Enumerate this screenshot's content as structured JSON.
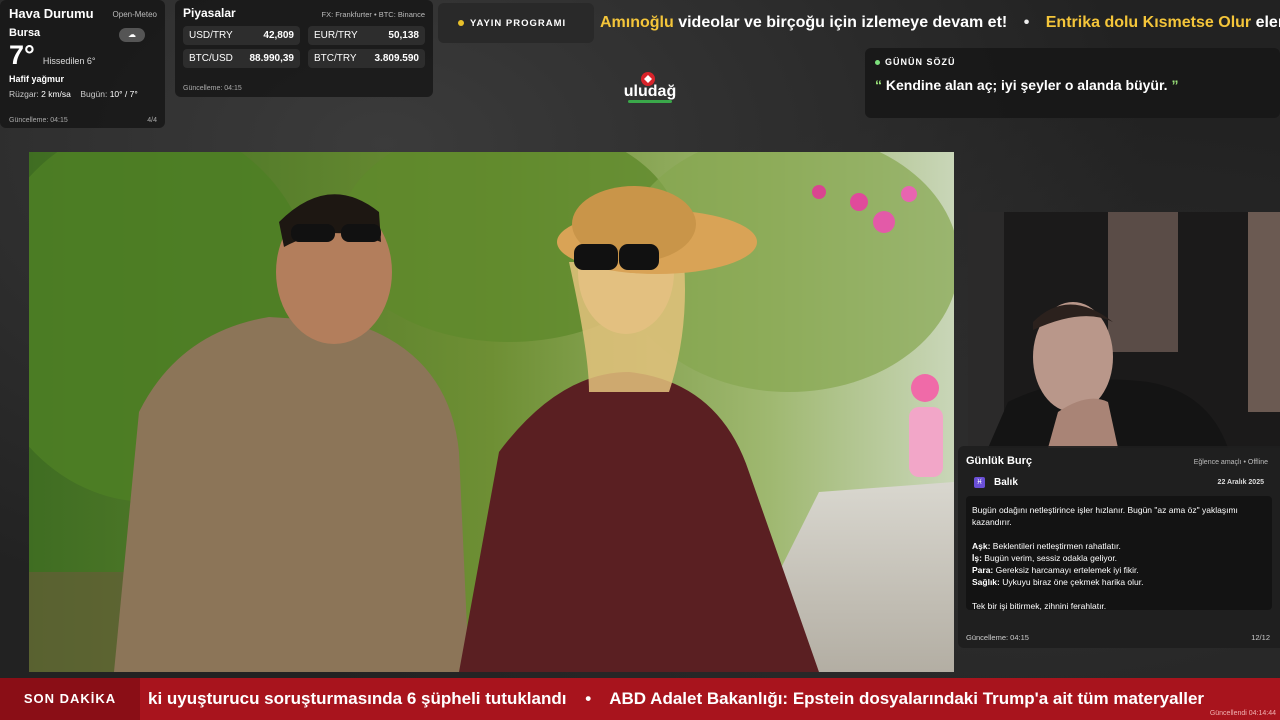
{
  "weather": {
    "title": "Hava Durumu",
    "source": "Open-Meteo",
    "city": "Bursa",
    "temp": "7°",
    "feels_like": "Hissedilen 6°",
    "condition": "Hafif yağmur",
    "wind_label": "Rüzgar:",
    "wind_value": "2 km/sa",
    "today_label": "Bugün:",
    "today_value": "10° / 7°",
    "updated": "Güncelleme: 04:15",
    "page": "4/4"
  },
  "markets": {
    "title": "Piyasalar",
    "source": "FX: Frankfurter • BTC: Binance",
    "items": [
      {
        "pair": "USD/TRY",
        "value": "42,809"
      },
      {
        "pair": "EUR/TRY",
        "value": "50,138"
      },
      {
        "pair": "BTC/USD",
        "value": "88.990,39"
      },
      {
        "pair": "BTC/TRY",
        "value": "3.809.590"
      }
    ],
    "updated": "Güncelleme: 04:15"
  },
  "schedule": {
    "label": "YAYIN PROGRAMI"
  },
  "top_marquee": {
    "items": [
      {
        "highlight": "Amınoğlu",
        "text": " videolar ve birçoğu için izlemeye devam et!"
      },
      {
        "highlight": "Entrika dolu Kısmetse Olur",
        "text": " eleme"
      }
    ],
    "separator": "•"
  },
  "logo": {
    "text": "uludağ"
  },
  "quote": {
    "title": "GÜNÜN SÖZÜ",
    "open_mark": "“",
    "text": "Kendine alan aç; iyi şeyler o alanda büyür.",
    "close_mark": "”"
  },
  "horoscope": {
    "title": "Günlük Burç",
    "source": "Eğlence amaçlı • Offline",
    "sign_icon": "♓",
    "sign": "Balık",
    "date": "22 Aralık 2025",
    "intro": "Bugün odağını netleştirince işler hızlanır. Bugün \"az ama öz\" yaklaşımı kazandırır.",
    "lines": [
      {
        "label": "Aşk:",
        "text": " Beklentileri netleştirmen rahatlatır."
      },
      {
        "label": "İş:",
        "text": " Bugün verim, sessiz odakla geliyor."
      },
      {
        "label": "Para:",
        "text": " Gereksiz harcamayı ertelemek iyi fikir."
      },
      {
        "label": "Sağlık:",
        "text": " Uykuyu biraz öne çekmek harika olur."
      }
    ],
    "tip": "Tek bir işi bitirmek, zihnini ferahlatır.",
    "updated": "Güncelleme: 04:15",
    "page": "12/12"
  },
  "breaking": {
    "label": "SON DAKİKA",
    "items": [
      "ki uyuşturucu soruşturmasında 6 şüpheli tutuklandı",
      "ABD Adalet Bakanlığı: Epstein dosyalarındaki Trump'a ait tüm materyaller"
    ],
    "separator": "•",
    "updated": "Güncellendi 04:14:44"
  },
  "colors": {
    "accent_yellow": "#f4c53a",
    "breaking_red": "#a8141d",
    "quote_green": "#9be37a",
    "sign_purple": "#6a4fd6"
  },
  "icons": {
    "weather": "cloud-rain-icon",
    "schedule": "dot-icon",
    "quote": "dot-icon",
    "sign": "pisces-icon"
  }
}
